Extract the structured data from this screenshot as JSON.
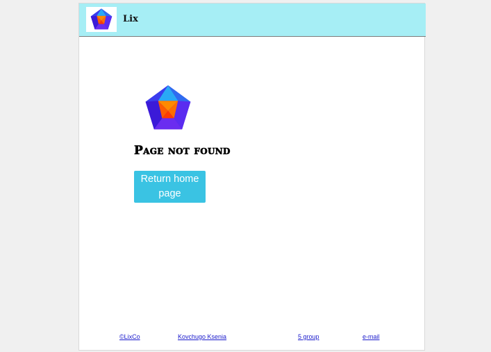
{
  "header": {
    "title": "Lix",
    "logo_icon": "lix-pentagon-logo-icon"
  },
  "main": {
    "logo_icon": "lix-pentagon-logo-icon",
    "heading": "Page not found",
    "return_button_label": "Return home page"
  },
  "footer": {
    "links": [
      "©LixCo",
      "Kovchugo Ksenia",
      "5 group",
      "e-mail"
    ]
  },
  "colors": {
    "header_bg": "#a6eef5",
    "button_bg": "#3ac3e3",
    "link": "#1a1acc",
    "logo_purple": "#5a1ee6",
    "logo_blue": "#2b7df0",
    "logo_orange": "#ff8a00",
    "logo_red": "#ff3b00"
  }
}
